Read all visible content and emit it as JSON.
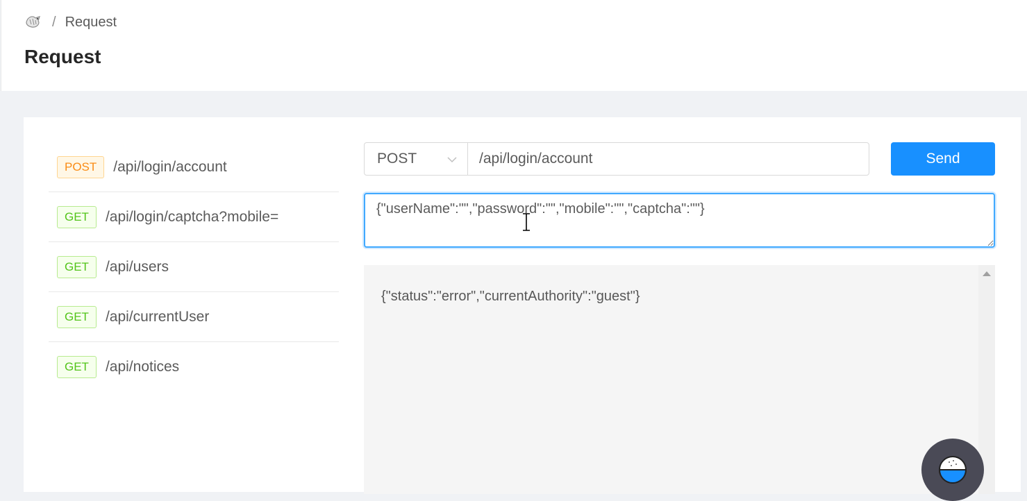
{
  "header": {
    "breadcrumb": {
      "home_icon": "home-icon",
      "separator": "/",
      "current": "Request"
    },
    "title": "Request"
  },
  "api_list": [
    {
      "method": "POST",
      "path": "/api/login/account",
      "method_color": "#fa8c16"
    },
    {
      "method": "GET",
      "path": "/api/login/captcha?mobile=",
      "method_color": "#52c41a"
    },
    {
      "method": "GET",
      "path": "/api/users",
      "method_color": "#52c41a"
    },
    {
      "method": "GET",
      "path": "/api/currentUser",
      "method_color": "#52c41a"
    },
    {
      "method": "GET",
      "path": "/api/notices",
      "method_color": "#52c41a"
    }
  ],
  "request": {
    "method": "POST",
    "url": "/api/login/account",
    "send_label": "Send",
    "body": "{\"userName\":\"\",\"password\":\"\",\"mobile\":\"\",\"captcha\":\"\"}"
  },
  "response": {
    "text": "{\"status\":\"error\",\"currentAuthority\":\"guest\"}"
  },
  "colors": {
    "primary": "#1890ff",
    "focus_border": "#40a9ff",
    "post_tag": "#fa8c16",
    "get_tag": "#52c41a"
  },
  "floating_widget": {
    "icon": "rice-bowl-icon"
  }
}
